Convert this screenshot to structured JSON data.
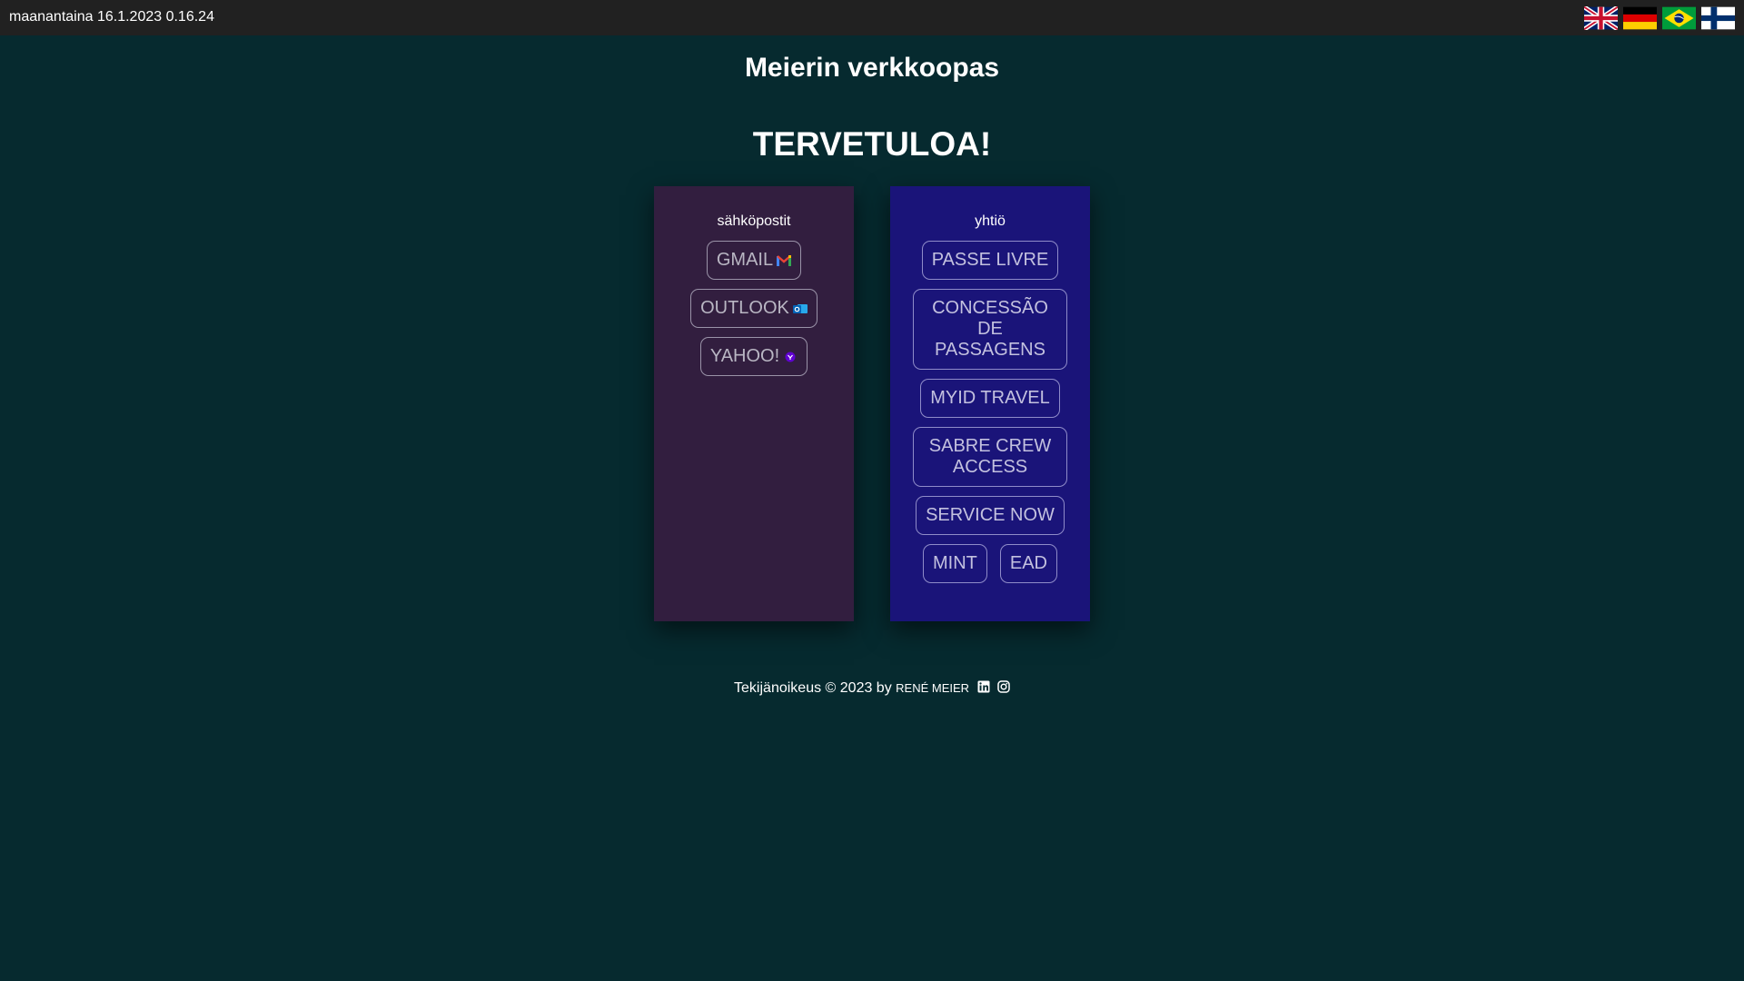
{
  "topbar": {
    "datetime": "maanantaina 16.1.2023 0.16.24",
    "flags": [
      {
        "icon": "uk-flag-icon"
      },
      {
        "icon": "germany-flag-icon"
      },
      {
        "icon": "brazil-flag-icon"
      },
      {
        "icon": "finland-flag-icon"
      }
    ]
  },
  "header": {
    "title": "Meierin verkkoopas",
    "welcome": "TERVETULOA!"
  },
  "mail_card": {
    "title": "sähköpostit",
    "buttons": [
      {
        "label": "GMAIL",
        "icon": "gmail-icon"
      },
      {
        "label": "OUTLOOK",
        "icon": "outlook-icon"
      },
      {
        "label": "YAHOO!",
        "icon": "yahoo-icon"
      }
    ]
  },
  "company_card": {
    "title": "yhtiö",
    "buttons": [
      {
        "label": "PASSE LIVRE"
      },
      {
        "label": "CONCESSÃO DE PASSAGENS"
      },
      {
        "label": "MYID TRAVEL"
      },
      {
        "label": "SABRE CREW ACCESS"
      },
      {
        "label": "SERVICE NOW"
      },
      {
        "label": "MINT"
      },
      {
        "label": "EAD"
      }
    ]
  },
  "footer": {
    "copyright": "Tekijänoikeus © 2023 by",
    "author": "RENÉ MEIER",
    "icons": [
      "linkedin-icon",
      "instagram-icon"
    ]
  },
  "colors": {
    "background": "#062a2f",
    "topbar": "#212121",
    "mail_card": "#321e3f",
    "company_card": "#1a1479"
  }
}
